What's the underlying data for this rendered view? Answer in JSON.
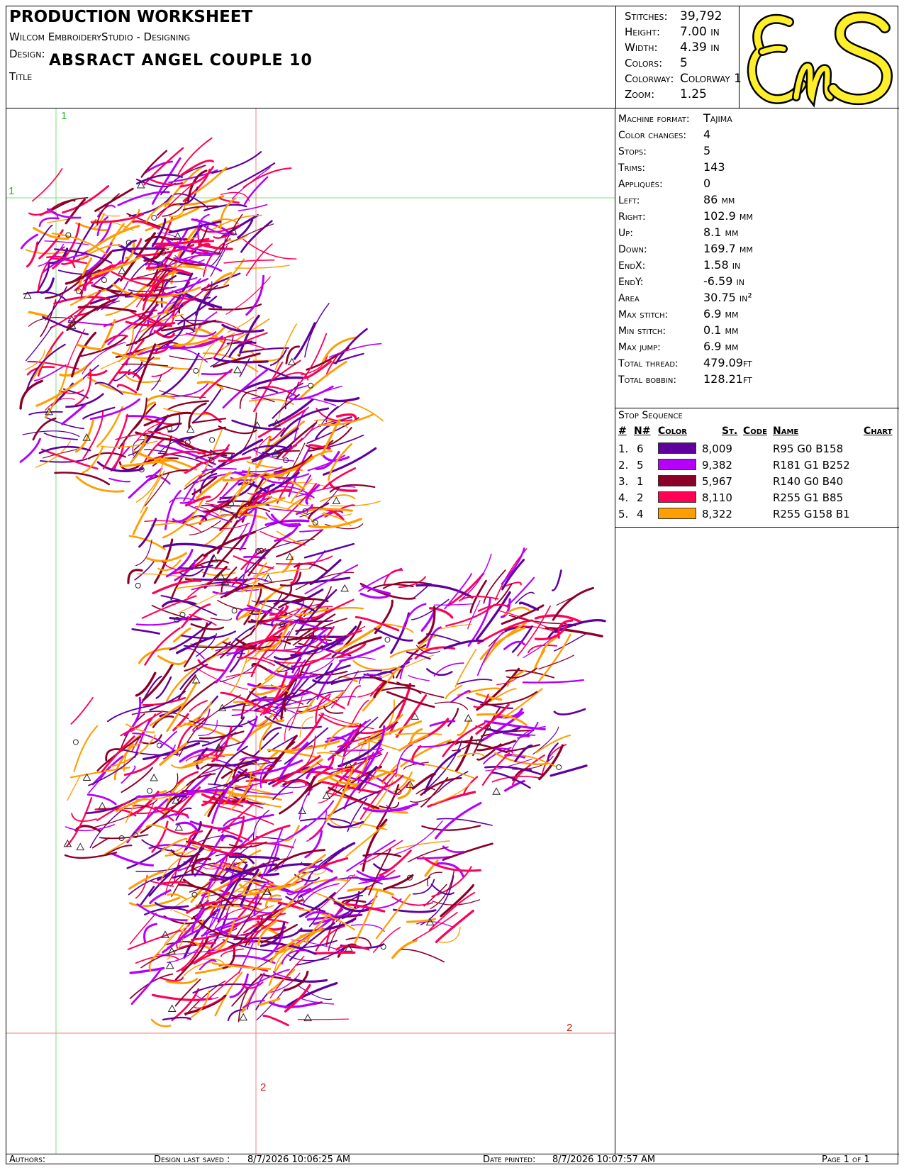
{
  "header": {
    "title": "PRODUCTION WORKSHEET",
    "software": "Wilcom EmbroideryStudio - Designing",
    "design_label": "Design:",
    "design_name": "ABSRACT ANGEL COUPLE  10",
    "title_label": "Title"
  },
  "stats": [
    {
      "label": "Stitches:",
      "value": "39,792"
    },
    {
      "label": "Height:",
      "value": "7.00 in"
    },
    {
      "label": "Width:",
      "value": "4.39 in"
    },
    {
      "label": "Colors:",
      "value": "5"
    },
    {
      "label": "Colorway:",
      "value": "Colorway 1"
    },
    {
      "label": "Zoom:",
      "value": "1.25"
    }
  ],
  "logo": {
    "text": "EnS",
    "color": "#ffef2a",
    "outline": "#000000"
  },
  "info": [
    {
      "label": "Machine format:",
      "value": "Tajima"
    },
    {
      "label": "Color changes:",
      "value": "4"
    },
    {
      "label": "Stops:",
      "value": "5"
    },
    {
      "label": "Trims:",
      "value": "143"
    },
    {
      "label": "Appliqués:",
      "value": "0"
    },
    {
      "label": "Left:",
      "value": "86 mm"
    },
    {
      "label": "Right:",
      "value": "102.9 mm"
    },
    {
      "label": "Up:",
      "value": "8.1 mm"
    },
    {
      "label": "Down:",
      "value": "169.7 mm"
    },
    {
      "label": "EndX:",
      "value": "1.58 in"
    },
    {
      "label": "EndY:",
      "value": "-6.59 in"
    },
    {
      "label": "Area",
      "value": "30.75 in²"
    },
    {
      "label": "Max stitch:",
      "value": "6.9 mm"
    },
    {
      "label": "Min stitch:",
      "value": "0.1 mm"
    },
    {
      "label": "Max jump:",
      "value": "6.9 mm"
    },
    {
      "label": "Total thread:",
      "value": "479.09ft"
    },
    {
      "label": "Total bobbin:",
      "value": "128.21ft"
    }
  ],
  "stop_sequence": {
    "title": "Stop Sequence",
    "headers": {
      "num": "#",
      "n": "N#",
      "color": "Color",
      "st": "St.",
      "code": "Code",
      "name": "Name",
      "chart": "Chart"
    },
    "rows": [
      {
        "num": "1.",
        "n": "6",
        "hex": "#5f009e",
        "st": "8,009",
        "name": "R95 G0 B158"
      },
      {
        "num": "2.",
        "n": "5",
        "hex": "#b501fc",
        "st": "9,382",
        "name": "R181 G1 B252"
      },
      {
        "num": "3.",
        "n": "1",
        "hex": "#8c0028",
        "st": "5,967",
        "name": "R140 G0 B40"
      },
      {
        "num": "4.",
        "n": "2",
        "hex": "#ff0155",
        "st": "8,110",
        "name": "R255 G1 B85"
      },
      {
        "num": "5.",
        "n": "4",
        "hex": "#ff9e01",
        "st": "8,322",
        "name": "R255 G158 B1"
      }
    ]
  },
  "canvas": {
    "guides": {
      "green_v_label": "1",
      "green_h_label": "1",
      "red_h_label": "2",
      "red_v_label": "2"
    },
    "guide_green": "#7ce27c",
    "guide_red": "#f08080"
  },
  "footer": {
    "authors_label": "Authors:",
    "saved_label": "Design last saved :",
    "saved_value": "8/7/2026 10:06:25 AM",
    "printed_label": "Date printed:",
    "printed_value": "8/7/2026 10:07:57 AM",
    "page": "Page 1 of 1"
  }
}
